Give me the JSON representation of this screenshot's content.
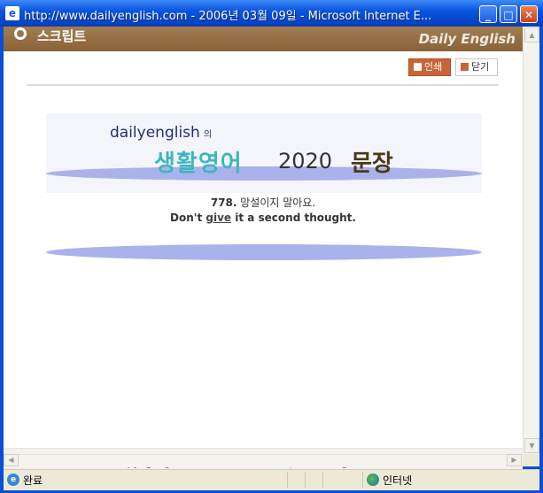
{
  "window": {
    "title": "http://www.dailyenglish.com - 2006년 03월 09일 - Microsoft Internet E...",
    "minimize": "_",
    "maximize": "□",
    "close": "✕"
  },
  "header": {
    "title": "스크립트",
    "logo": "Daily English"
  },
  "toolbar": {
    "print_label": "인쇄",
    "close_label": "닫기"
  },
  "banner": {
    "brand": "dailyenglish",
    "brand_suffix": "의",
    "title_part1": "생활영어",
    "title_part2": "2020",
    "title_part3": "문장"
  },
  "sentence": {
    "number": "778.",
    "korean": "망설이지 말아요.",
    "english_pre": "Don't ",
    "english_key": "give",
    "english_post": " it a second thought."
  },
  "footer": {
    "prefix": "Copyright@",
    "company": "DEN Communications, Inc.",
    "suffix": " All rights reserved."
  },
  "statusbar": {
    "status": "완료",
    "zone": "인터넷"
  },
  "colors": {
    "header_bg": "#957044",
    "print_bg": "#c9643a",
    "ellipse": "#a9b2ea",
    "title_teal": "#3db6bf",
    "company_orange": "#c9651f"
  }
}
